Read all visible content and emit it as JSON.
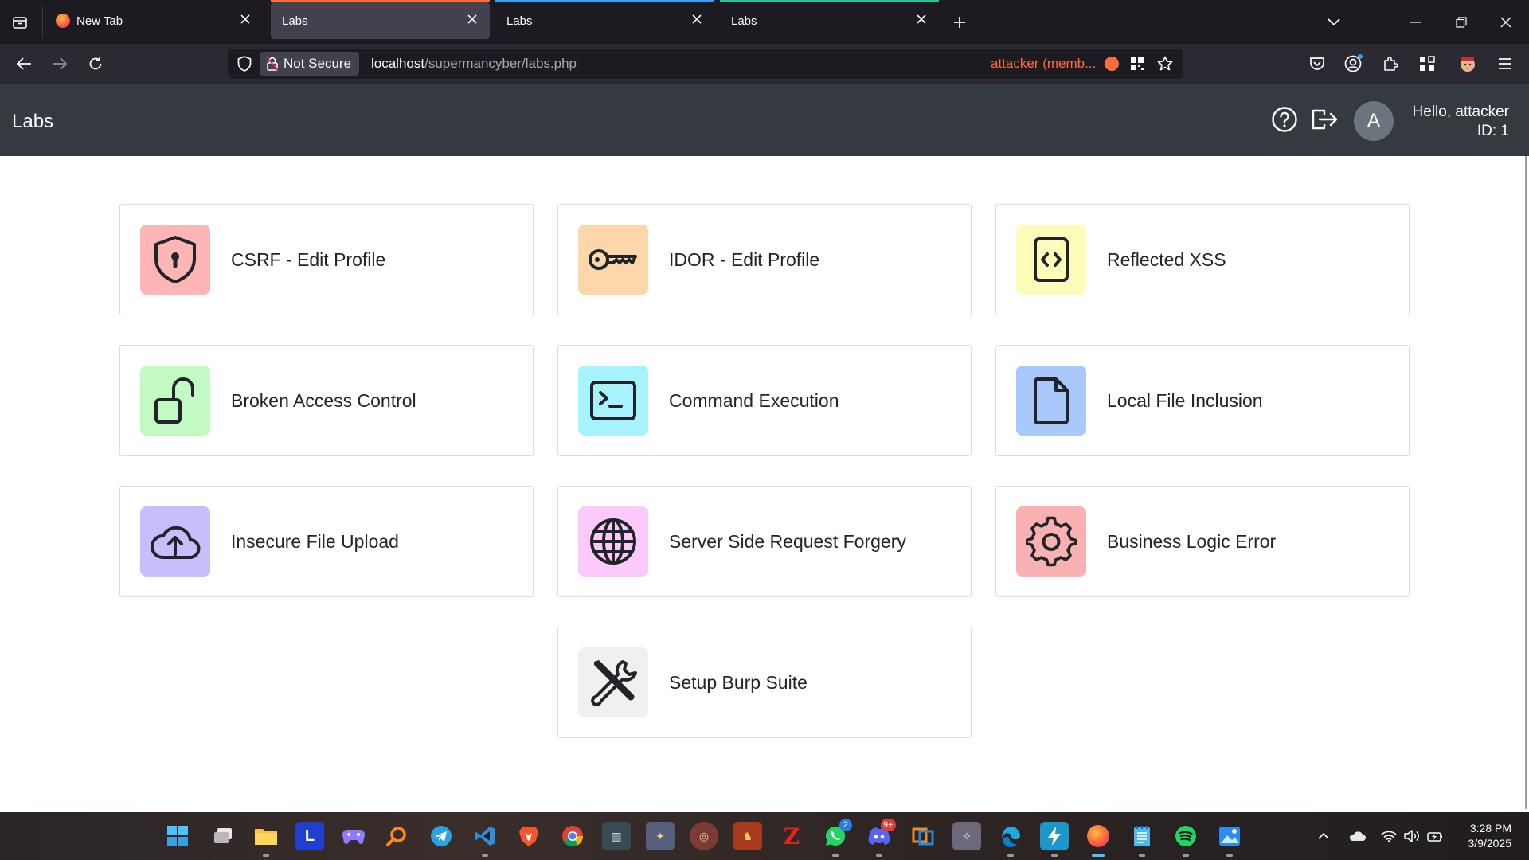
{
  "browser": {
    "tabs": [
      {
        "label": "New Tab",
        "accent": "",
        "active": false
      },
      {
        "label": "Labs",
        "accent": "#ff6b3d",
        "active": true
      },
      {
        "label": "Labs",
        "accent": "#3b9cf6",
        "active": false
      },
      {
        "label": "Labs",
        "accent": "#2ac3a2",
        "active": false
      }
    ],
    "url": {
      "security_label": "Not Secure",
      "host": "localhost",
      "path": "/supermancyber/labs.php",
      "container_label": "attacker (memb...",
      "container_color": "#ff6b3d"
    }
  },
  "app": {
    "title": "Labs",
    "greeting": "Hello, attacker",
    "user_id": "ID: 1",
    "avatar_letter": "A"
  },
  "labs": [
    {
      "label": "CSRF - Edit Profile",
      "icon": "shield-keyhole-icon",
      "color": "#fdb5b6"
    },
    {
      "label": "IDOR - Edit Profile",
      "icon": "key-icon",
      "color": "#fdd7a9"
    },
    {
      "label": "Reflected XSS",
      "icon": "code-file-icon",
      "color": "#fefcb9"
    },
    {
      "label": "Broken Access Control",
      "icon": "unlocked-padlock-icon",
      "color": "#c3fac3"
    },
    {
      "label": "Command Execution",
      "icon": "terminal-icon",
      "color": "#a6f3fb"
    },
    {
      "label": "Local File Inclusion",
      "icon": "file-icon",
      "color": "#a9c8fb"
    },
    {
      "label": "Insecure File Upload",
      "icon": "cloud-upload-icon",
      "color": "#c9bdfb"
    },
    {
      "label": "Server Side Request Forgery",
      "icon": "globe-icon",
      "color": "#fbcafb"
    },
    {
      "label": "Business Logic Error",
      "icon": "gear-icon",
      "color": "#f9b1b1"
    },
    {
      "label": "Setup Burp Suite",
      "icon": "tools-icon",
      "color": "#f0f0f0"
    }
  ],
  "taskbar": {
    "badges": {
      "whatsapp": "2",
      "discord": "9+"
    },
    "time": "3:28 PM",
    "date": "3/9/2025"
  }
}
